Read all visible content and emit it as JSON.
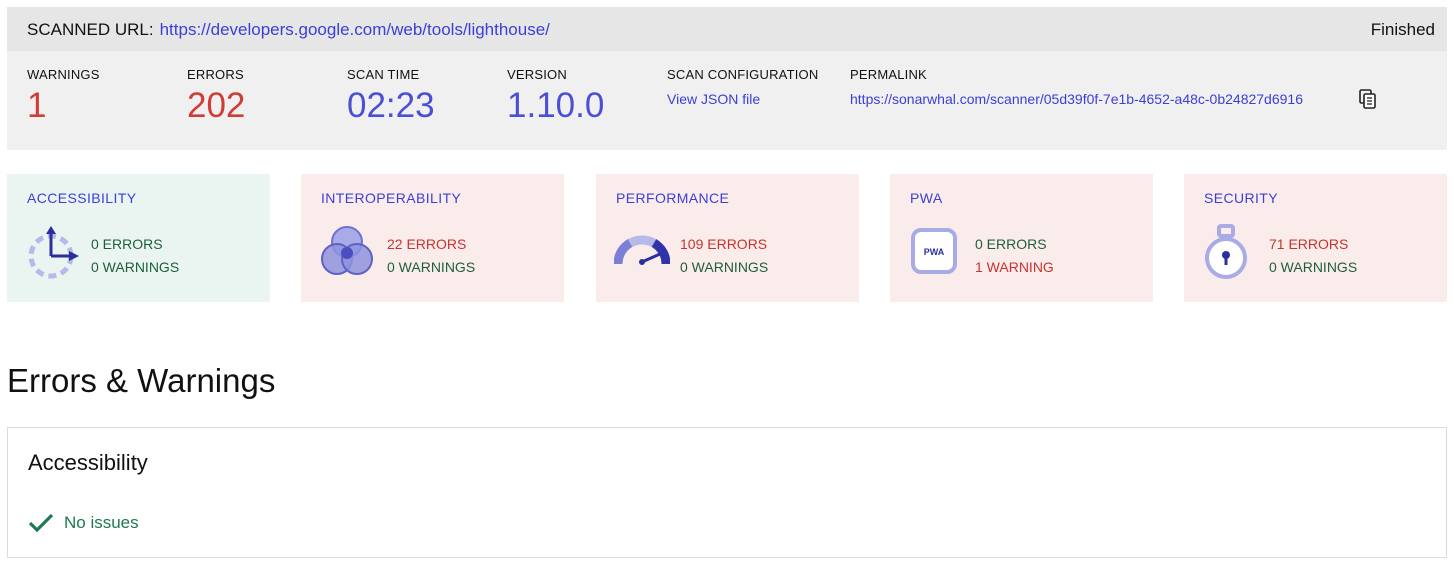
{
  "header": {
    "label": "SCANNED URL:",
    "url": "https://developers.google.com/web/tools/lighthouse/",
    "status": "Finished"
  },
  "summary": {
    "warnings": {
      "label": "WARNINGS",
      "value": "1"
    },
    "errors": {
      "label": "ERRORS",
      "value": "202"
    },
    "scan_time": {
      "label": "SCAN TIME",
      "value": "02:23"
    },
    "version": {
      "label": "VERSION",
      "value": "1.10.0"
    },
    "scan_config": {
      "label": "SCAN CONFIGURATION",
      "link": "View JSON file"
    },
    "permalink": {
      "label": "PERMALINK",
      "link": "https://sonarwhal.com/scanner/05d39f0f-7e1b-4652-a48c-0b24827d6916"
    }
  },
  "categories": [
    {
      "title": "ACCESSIBILITY",
      "errors": "0 ERRORS",
      "warnings": "0 WARNINGS",
      "icon": "accessibility-icon",
      "status": "ok"
    },
    {
      "title": "INTEROPERABILITY",
      "errors": "22 ERRORS",
      "warnings": "0 WARNINGS",
      "icon": "interoperability-icon",
      "status": "bad"
    },
    {
      "title": "PERFORMANCE",
      "errors": "109 ERRORS",
      "warnings": "0 WARNINGS",
      "icon": "performance-gauge-icon",
      "status": "bad"
    },
    {
      "title": "PWA",
      "errors": "0 ERRORS",
      "warnings": "1 WARNING",
      "icon": "pwa-icon",
      "icon_text": "PWA",
      "status": "bad"
    },
    {
      "title": "SECURITY",
      "errors": "71 ERRORS",
      "warnings": "0 WARNINGS",
      "icon": "security-lock-icon",
      "status": "bad"
    }
  ],
  "errors_section": {
    "title": "Errors & Warnings",
    "panel_title": "Accessibility",
    "panel_status": "No issues"
  },
  "colors": {
    "accent_blue": "#3b3fd8",
    "error_red": "#d23c36",
    "ok_green": "#1e7a4f",
    "ok_card_bg": "#eaf5f2",
    "bad_card_bg": "#fbecec",
    "icon_purple": "#7b7fd6"
  }
}
